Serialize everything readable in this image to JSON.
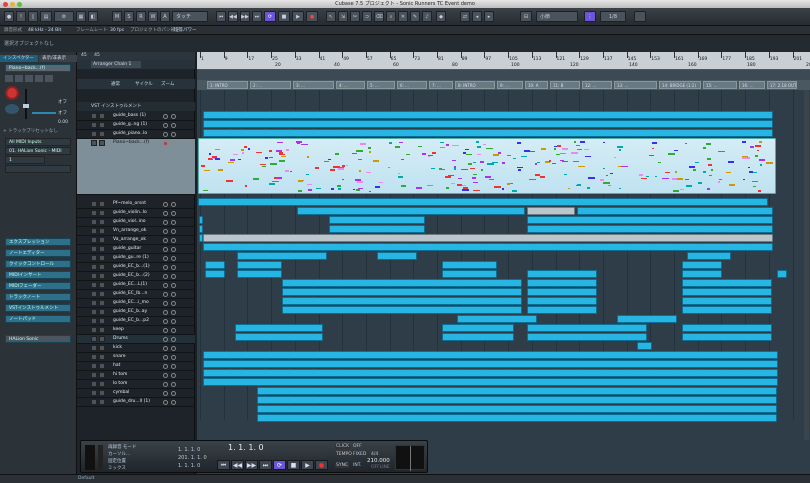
{
  "window": {
    "title": "Cubase 7.5 プロジェクト - Sonic Runners TC Event demo"
  },
  "toolbar": {
    "buttons": [
      "M",
      "S",
      "R",
      "W",
      "A",
      "タッチ"
    ],
    "snap": "1/8",
    "grid": "小節",
    "quantize": "1/8"
  },
  "infobar": {
    "items": [
      "録音形式",
      "48 kHz - 24 Bit",
      "フレームレート",
      "30 fps",
      "プロジェクトのパン補正",
      "均等パワー"
    ]
  },
  "status": {
    "text": "選択オブジェクトなし"
  },
  "inspector": {
    "tabs": [
      "インスペクター",
      "表示/非表示"
    ],
    "track_name": "Piano~back...(f)",
    "value_off": "オフ",
    "value_num": "0.00",
    "drop_label": "+ トラックプリセットなし",
    "input": "All MIDI Inputs",
    "output": "01. HALion Sonic - MIDI",
    "chord": "+ 01. HALion Sonic - MIDI",
    "sections": [
      "エクスプレッション",
      "ノートエディター",
      "クイックコントロール",
      "MIDIインサート",
      "MIDIフェーダー",
      "トラックノート",
      "VSTインストゥルメント",
      "ノートパッド"
    ],
    "instrument": "HALion Sonic"
  },
  "tracklist": {
    "header_val": "45",
    "header_val2": "45",
    "arranger": "Arranger Chain 1",
    "row3": [
      "通常",
      "サイクル",
      "ズーム"
    ],
    "folder": "VST インストゥルメント",
    "tracks": [
      {
        "name": "guide_bass (1)",
        "type": "audio"
      },
      {
        "name": "guide_g..ng (1)",
        "type": "audio"
      },
      {
        "name": "guide_piano..lo",
        "type": "audio"
      },
      {
        "name": "Piano~back...(f)",
        "type": "midi-sel"
      },
      {
        "name": "Pf~melo_orsnt",
        "type": "audio"
      },
      {
        "name": "guide_violin..lo",
        "type": "audio"
      },
      {
        "name": "guide_viol..ino",
        "type": "audio"
      },
      {
        "name": "Vn_arrange_ok",
        "type": "audio"
      },
      {
        "name": "Va_arrange_ok",
        "type": "audio"
      },
      {
        "name": "guide_guitar",
        "type": "audio"
      },
      {
        "name": "guide_gu..re (1)",
        "type": "audio"
      },
      {
        "name": "guide_EC_b...(1)",
        "type": "audio"
      },
      {
        "name": "guide_EC_b...(2)",
        "type": "audio"
      },
      {
        "name": "guide_EC...L(1)",
        "type": "audio"
      },
      {
        "name": "guide_EC_lb...n",
        "type": "audio"
      },
      {
        "name": "guide_EC...i_mo",
        "type": "audio"
      },
      {
        "name": "guide_EC_b..ay",
        "type": "audio"
      },
      {
        "name": "guide_EC_b...p2",
        "type": "audio"
      },
      {
        "name": "keep",
        "type": "audio"
      },
      {
        "name": "Drums",
        "type": "folder"
      },
      {
        "name": "kick",
        "type": "audio"
      },
      {
        "name": "snare",
        "type": "audio"
      },
      {
        "name": "hat",
        "type": "audio"
      },
      {
        "name": "hi tom",
        "type": "audio"
      },
      {
        "name": "lo tom",
        "type": "audio"
      },
      {
        "name": "cymbal",
        "type": "audio"
      },
      {
        "name": "guide_dru...ll (1)",
        "type": "audio"
      }
    ]
  },
  "ruler": {
    "bars": [
      "1",
      "9",
      "17",
      "25",
      "33",
      "41",
      "49",
      "57",
      "65",
      "73",
      "81",
      "89",
      "97",
      "105",
      "113",
      "121",
      "129",
      "137",
      "145",
      "153",
      "161",
      "169",
      "177",
      "185",
      "193",
      "201"
    ],
    "sub": [
      "20",
      "40",
      "60",
      "80",
      "100",
      "120",
      "140",
      "160",
      "180",
      "200"
    ]
  },
  "markers": [
    "1: INTRO",
    "2: ...",
    "3: ...",
    "4: ...",
    "5: ...",
    "6: ...",
    "7: ...",
    "8: INTRO",
    "9: ...",
    "10: A",
    "11: B",
    "12: ...",
    "13: ...",
    "14: BRIDGE (1:2)",
    "15: ...",
    "16: ...",
    "17: 2.18 OUTRO"
  ],
  "transport": {
    "pos1": "1. 1. 1. 0",
    "pos2": "1. 1. 1. 0",
    "pos3": "201. 1. 1. 0",
    "main": "1. 1. 1. 0",
    "tempo": "210.000",
    "sig": "4/4",
    "click": "CLICK",
    "click_state": "OFF",
    "tempo_label": "TEMPO",
    "tempo_state": "FIXED",
    "sync": "SYNC",
    "sync_state": "INT.",
    "offline": "OFFLINE",
    "labels": [
      "再録音 モード",
      "カーソル...",
      "固定位置",
      "ミックス"
    ],
    "auto": "AutoQ"
  },
  "bottom": {
    "text": "Default"
  }
}
